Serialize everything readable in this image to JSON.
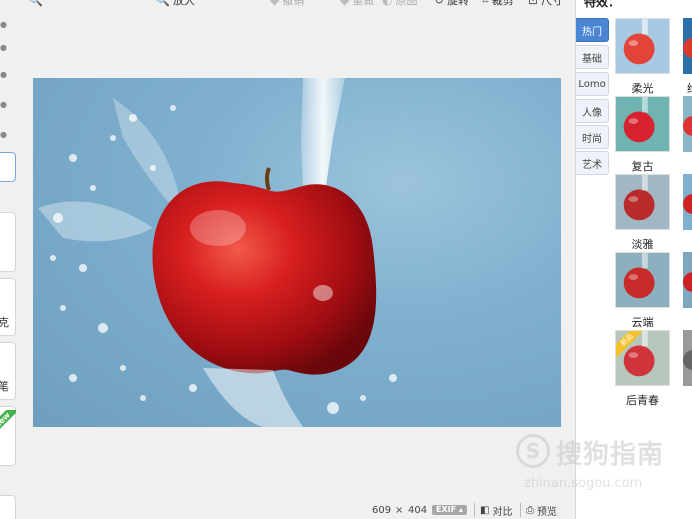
{
  "toolbar": {
    "items": [
      {
        "label": "",
        "icon": "zoom-icon"
      },
      {
        "label": "放大",
        "icon": "zoom-in-icon"
      },
      {
        "label": "撤销",
        "icon": "undo-icon"
      },
      {
        "label": "重做",
        "icon": "redo-icon"
      },
      {
        "label": "原图",
        "icon": "original-icon"
      },
      {
        "label": "旋转",
        "icon": "rotate-icon"
      },
      {
        "label": "裁剪",
        "icon": "crop-icon"
      },
      {
        "label": "尺寸",
        "icon": "resize-icon"
      }
    ]
  },
  "left_strip": {
    "labels": [
      "克",
      "笔"
    ],
    "new_ribbon": "New"
  },
  "status": {
    "width": "609",
    "times": "×",
    "height": "404",
    "exif": "EXIF ▴",
    "compare": "对比",
    "preview": "预览"
  },
  "effects_panel": {
    "title": "特效：",
    "tabs": [
      {
        "label": "热门",
        "active": true
      },
      {
        "label": "基础",
        "active": false
      },
      {
        "label": "Lomo",
        "active": false
      },
      {
        "label": "人像",
        "active": false
      },
      {
        "label": "时尚",
        "active": false
      },
      {
        "label": "艺术",
        "active": false
      }
    ],
    "thumbnails": [
      {
        "label": "柔光",
        "partial_label": "给"
      },
      {
        "label": "复古",
        "partial_label": ""
      },
      {
        "label": "淡雅",
        "partial_label": ""
      },
      {
        "label": "云端",
        "partial_label": ""
      },
      {
        "label": "后青春",
        "partial_label": "",
        "badge": "新品"
      }
    ]
  },
  "watermark": {
    "logo": "S",
    "brand": "搜狗指南",
    "url": "zhinan.sogou.com"
  },
  "colors": {
    "accent": "#4a86d4",
    "panel_bg": "#ffffff",
    "app_bg": "#f0f0f0"
  }
}
